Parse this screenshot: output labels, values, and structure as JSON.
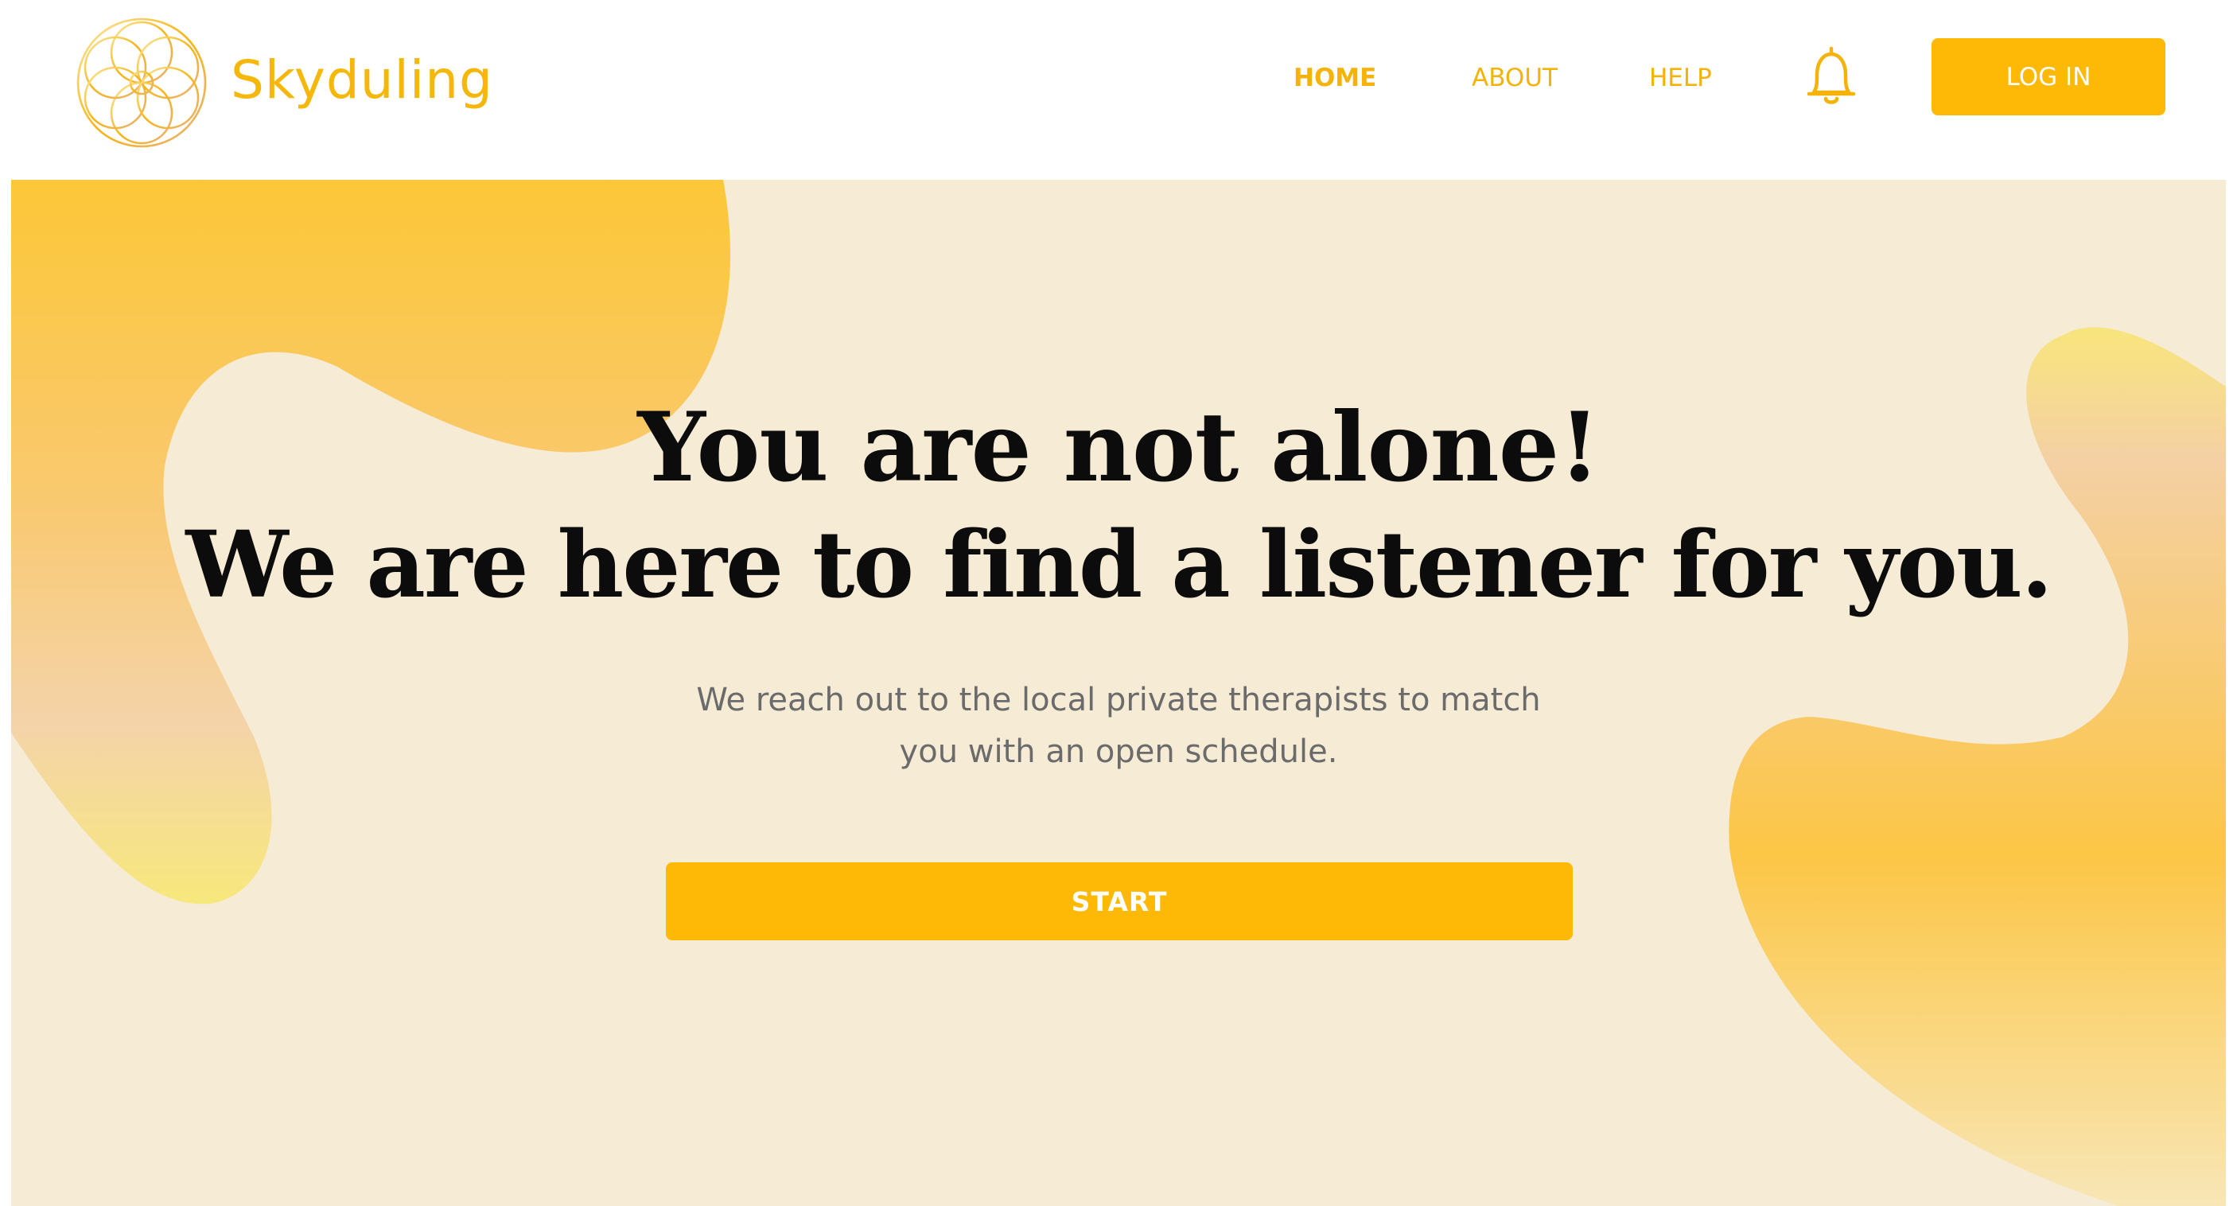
{
  "brand": {
    "name": "Skyduling",
    "logo_icon": "flower-of-life-logo"
  },
  "nav": {
    "home": "HOME",
    "about": "ABOUT",
    "help": "HELP",
    "notifications_icon": "bell-icon",
    "login_label": "LOG IN"
  },
  "hero": {
    "headline_line1": "You are not alone!",
    "headline_line2": "We are here to find a listener for you.",
    "subtext_line1": "We reach out to the local private therapists to match",
    "subtext_line2": "you with an open schedule.",
    "start_label": "START"
  },
  "colors": {
    "accent": "#fdb905",
    "brand_text": "#f5b80a",
    "hero_background": "#f6ebd5",
    "headline": "#0c0c0c",
    "subtext": "#6b6b6b"
  }
}
